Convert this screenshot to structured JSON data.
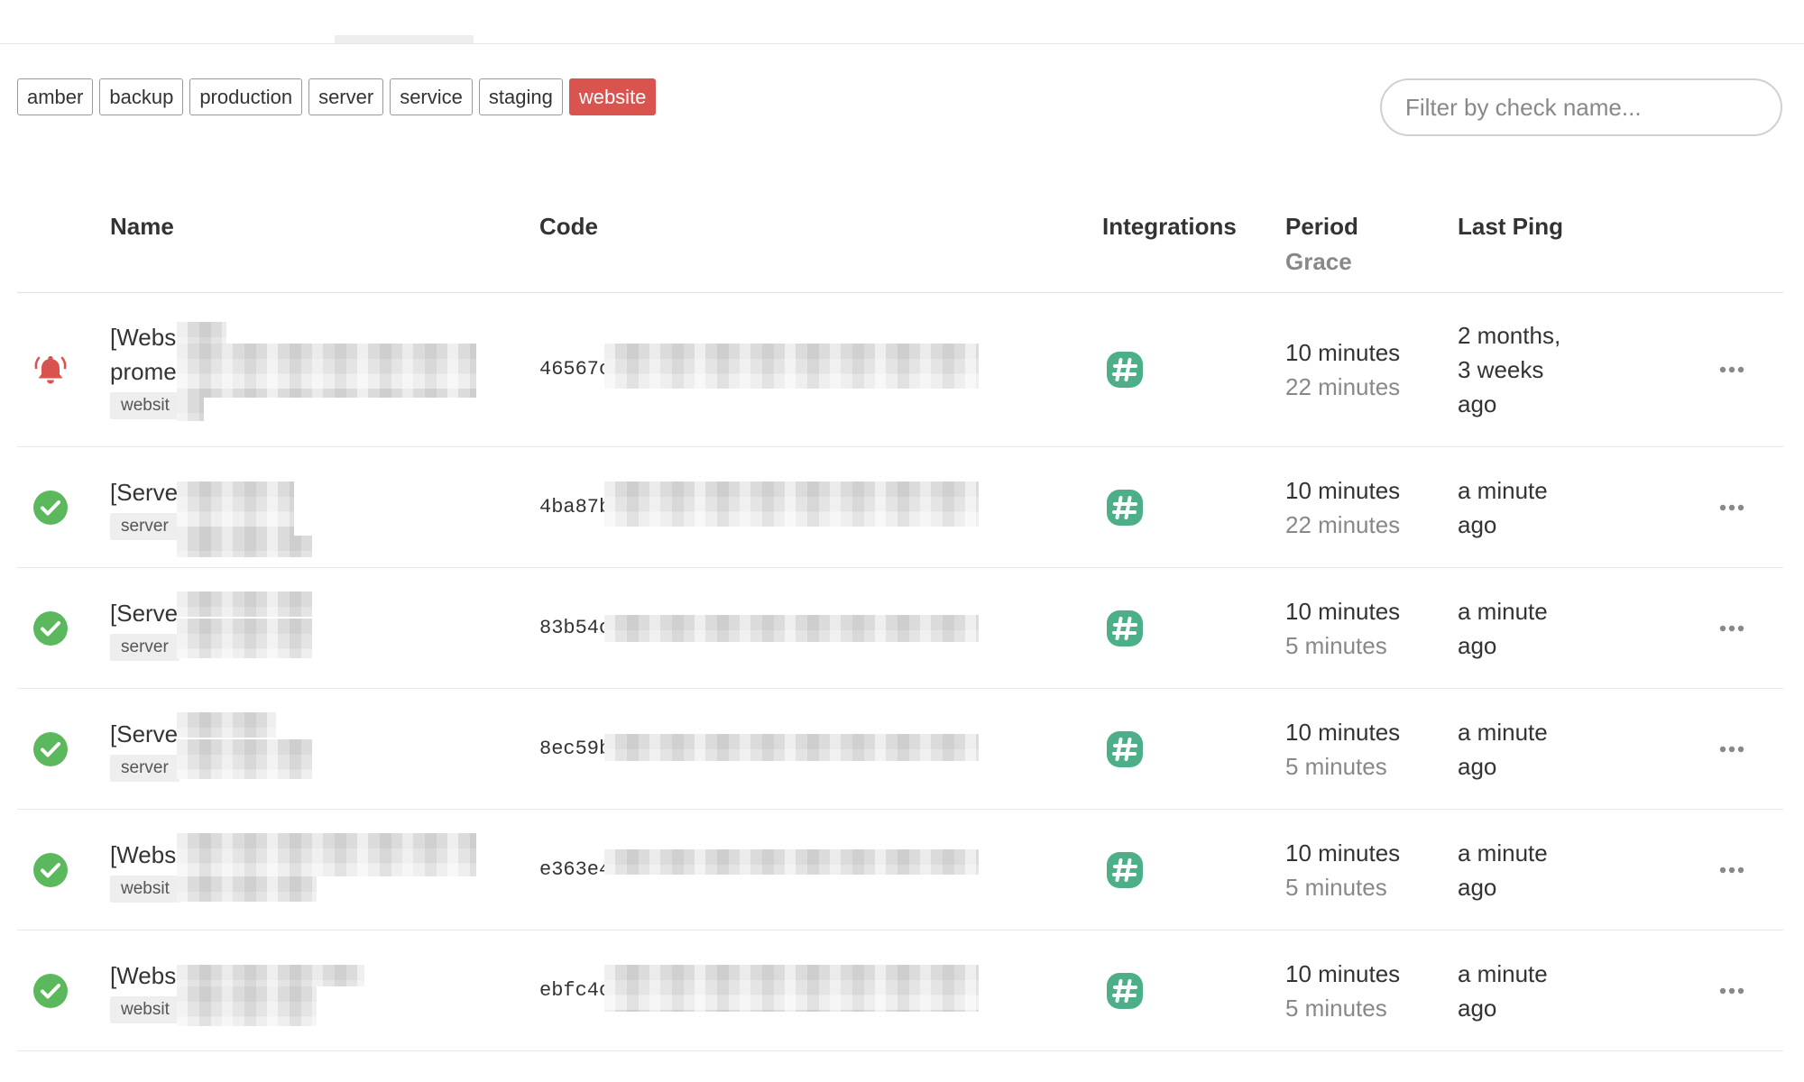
{
  "tags": [
    {
      "label": "amber",
      "active": false
    },
    {
      "label": "backup",
      "active": false
    },
    {
      "label": "production",
      "active": false
    },
    {
      "label": "server",
      "active": false
    },
    {
      "label": "service",
      "active": false
    },
    {
      "label": "staging",
      "active": false
    },
    {
      "label": "website",
      "active": true
    }
  ],
  "filter": {
    "placeholder": "Filter by check name..."
  },
  "table": {
    "headers": {
      "name": "Name",
      "code": "Code",
      "integrations": "Integrations",
      "period": "Period",
      "grace": "Grace",
      "last_ping": "Last Ping"
    },
    "rows": [
      {
        "status": "down",
        "status_icon": "bell-icon",
        "name_lines": [
          "[Webs",
          "prome"
        ],
        "tag": "websit",
        "code": "46567c",
        "integration_icon": "slack-icon",
        "period": "10 minutes",
        "grace": "22 minutes",
        "last_ping": [
          "2 months,",
          "3 weeks",
          "ago"
        ]
      },
      {
        "status": "up",
        "status_icon": "check-circle-icon",
        "name_lines": [
          "[Serve"
        ],
        "tag": "server",
        "code": "4ba87b",
        "integration_icon": "slack-icon",
        "period": "10 minutes",
        "grace": "22 minutes",
        "last_ping": [
          "a minute",
          "ago"
        ]
      },
      {
        "status": "up",
        "status_icon": "check-circle-icon",
        "name_lines": [
          "[Serve"
        ],
        "tag": "server",
        "code": "83b54c",
        "integration_icon": "slack-icon",
        "period": "10 minutes",
        "grace": "5 minutes",
        "last_ping": [
          "a minute",
          "ago"
        ]
      },
      {
        "status": "up",
        "status_icon": "check-circle-icon",
        "name_lines": [
          "[Serve"
        ],
        "tag": "server",
        "code": "8ec59b",
        "integration_icon": "slack-icon",
        "period": "10 minutes",
        "grace": "5 minutes",
        "last_ping": [
          "a minute",
          "ago"
        ]
      },
      {
        "status": "up",
        "status_icon": "check-circle-icon",
        "name_lines": [
          "[Webs"
        ],
        "tag": "websit",
        "code": "e363e4",
        "integration_icon": "slack-icon",
        "period": "10 minutes",
        "grace": "5 minutes",
        "last_ping": [
          "a minute",
          "ago"
        ]
      },
      {
        "status": "up",
        "status_icon": "check-circle-icon",
        "name_lines": [
          "[Webs"
        ],
        "tag": "websit",
        "code": "ebfc4c",
        "integration_icon": "slack-icon",
        "period": "10 minutes",
        "grace": "5 minutes",
        "last_ping": [
          "a minute",
          "ago"
        ]
      }
    ]
  },
  "colors": {
    "down": "#d9534f",
    "up": "#5cb85c",
    "integration": "#4caf87",
    "tag_active": "#d9534f",
    "muted": "#888888"
  }
}
